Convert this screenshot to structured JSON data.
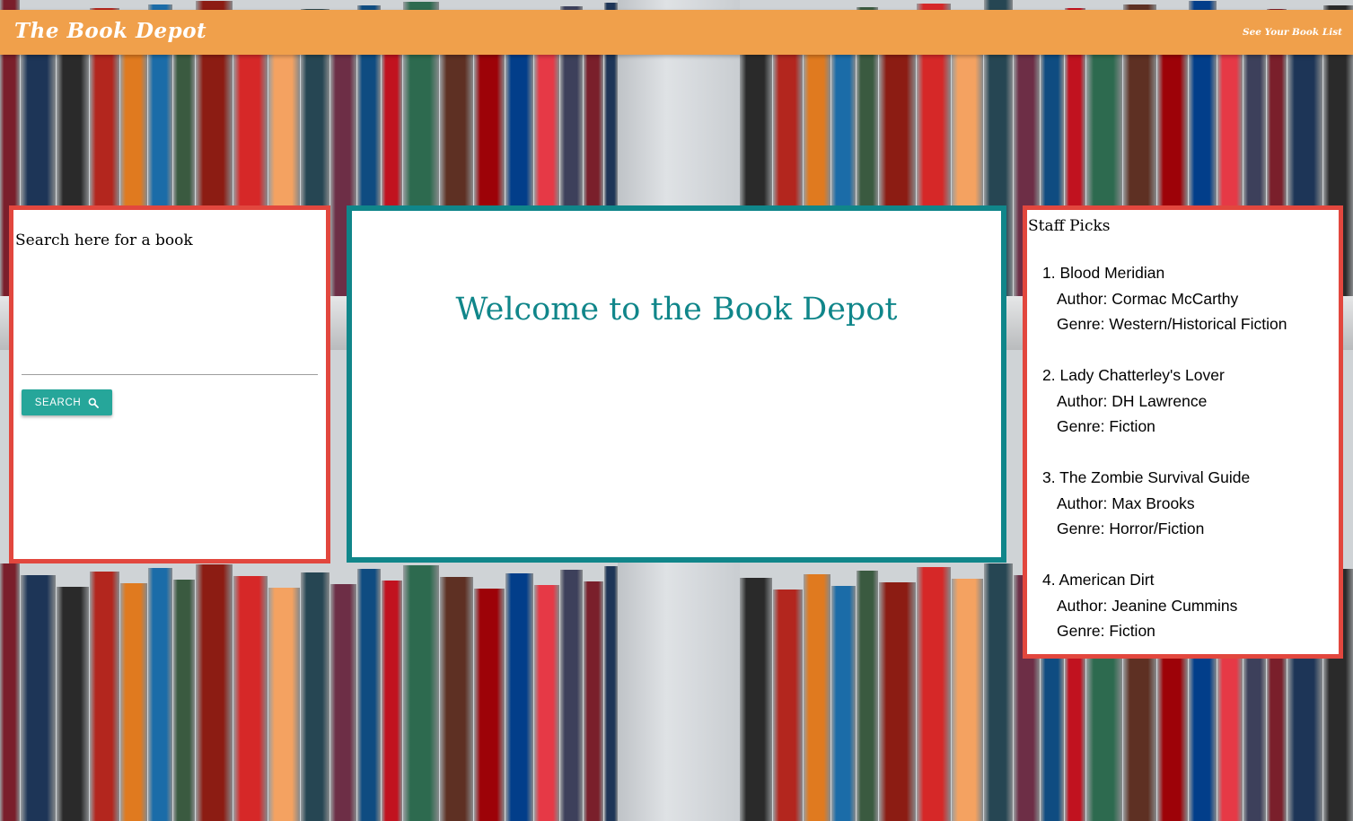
{
  "navbar": {
    "brand": "The Book Depot",
    "link": "See Your Book List"
  },
  "search": {
    "heading": "Search here for a book",
    "input_value": "",
    "button_label": "SEARCH",
    "button_icon": "search-icon"
  },
  "welcome": {
    "title": "Welcome to the Book Depot"
  },
  "staff_picks": {
    "title": "Staff Picks",
    "items": [
      {
        "num": "1.",
        "title": "Blood Meridian",
        "author": "Author: Cormac McCarthy",
        "genre": "Genre: Western/Historical Fiction"
      },
      {
        "num": "2.",
        "title": "Lady Chatterley's Lover",
        "author": "Author: DH Lawrence",
        "genre": "Genre: Fiction"
      },
      {
        "num": "3.",
        "title": "The Zombie Survival Guide",
        "author": "Author: Max Brooks",
        "genre": "Genre: Horror/Fiction"
      },
      {
        "num": "4.",
        "title": "American Dirt",
        "author": "Author: Jeanine Cummins",
        "genre": "Genre: Fiction"
      }
    ]
  },
  "colors": {
    "navbar": "#f0a04b",
    "panel_border_red": "#e2473e",
    "panel_border_teal": "#10868a",
    "button": "#26a69a"
  }
}
